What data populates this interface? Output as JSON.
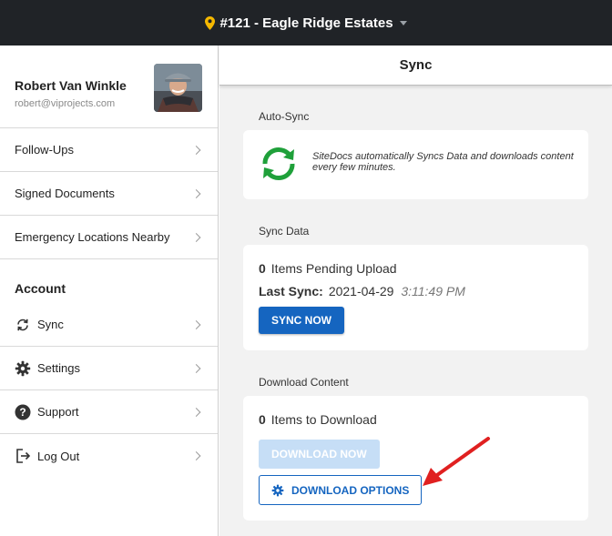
{
  "topbar": {
    "project_label": "#121  - Eagle Ridge Estates",
    "pin_icon": "map-pin-icon",
    "pin_color": "#f5b800"
  },
  "profile": {
    "name": "Robert Van Winkle",
    "email": "robert@viprojects.com"
  },
  "sidebar": {
    "items": [
      {
        "label": "Follow-Ups"
      },
      {
        "label": "Signed Documents"
      },
      {
        "label": "Emergency Locations Nearby"
      }
    ],
    "account_heading": "Account",
    "account_items": [
      {
        "label": "Sync",
        "icon": "sync-icon"
      },
      {
        "label": "Settings",
        "icon": "gear-icon"
      },
      {
        "label": "Support",
        "icon": "help-icon"
      },
      {
        "label": "Log Out",
        "icon": "logout-icon"
      }
    ]
  },
  "main": {
    "title": "Sync",
    "auto_sync": {
      "label": "Auto-Sync",
      "description": "SiteDocs automatically Syncs Data and downloads content every few minutes."
    },
    "sync_data": {
      "label": "Sync Data",
      "pending_count": "0",
      "pending_label": "Items Pending Upload",
      "last_sync_label": "Last Sync:",
      "last_sync_date": "2021-04-29",
      "last_sync_time": "3:11:49 PM",
      "button_label": "SYNC NOW"
    },
    "download": {
      "label": "Download Content",
      "count": "0",
      "count_label": "Items to Download",
      "download_now_label": "DOWNLOAD NOW",
      "options_label": "DOWNLOAD OPTIONS"
    }
  },
  "colors": {
    "accent": "#1565c0",
    "sync_green": "#1fa03a",
    "annotation_red": "#e02020",
    "topbar": "#202327"
  }
}
